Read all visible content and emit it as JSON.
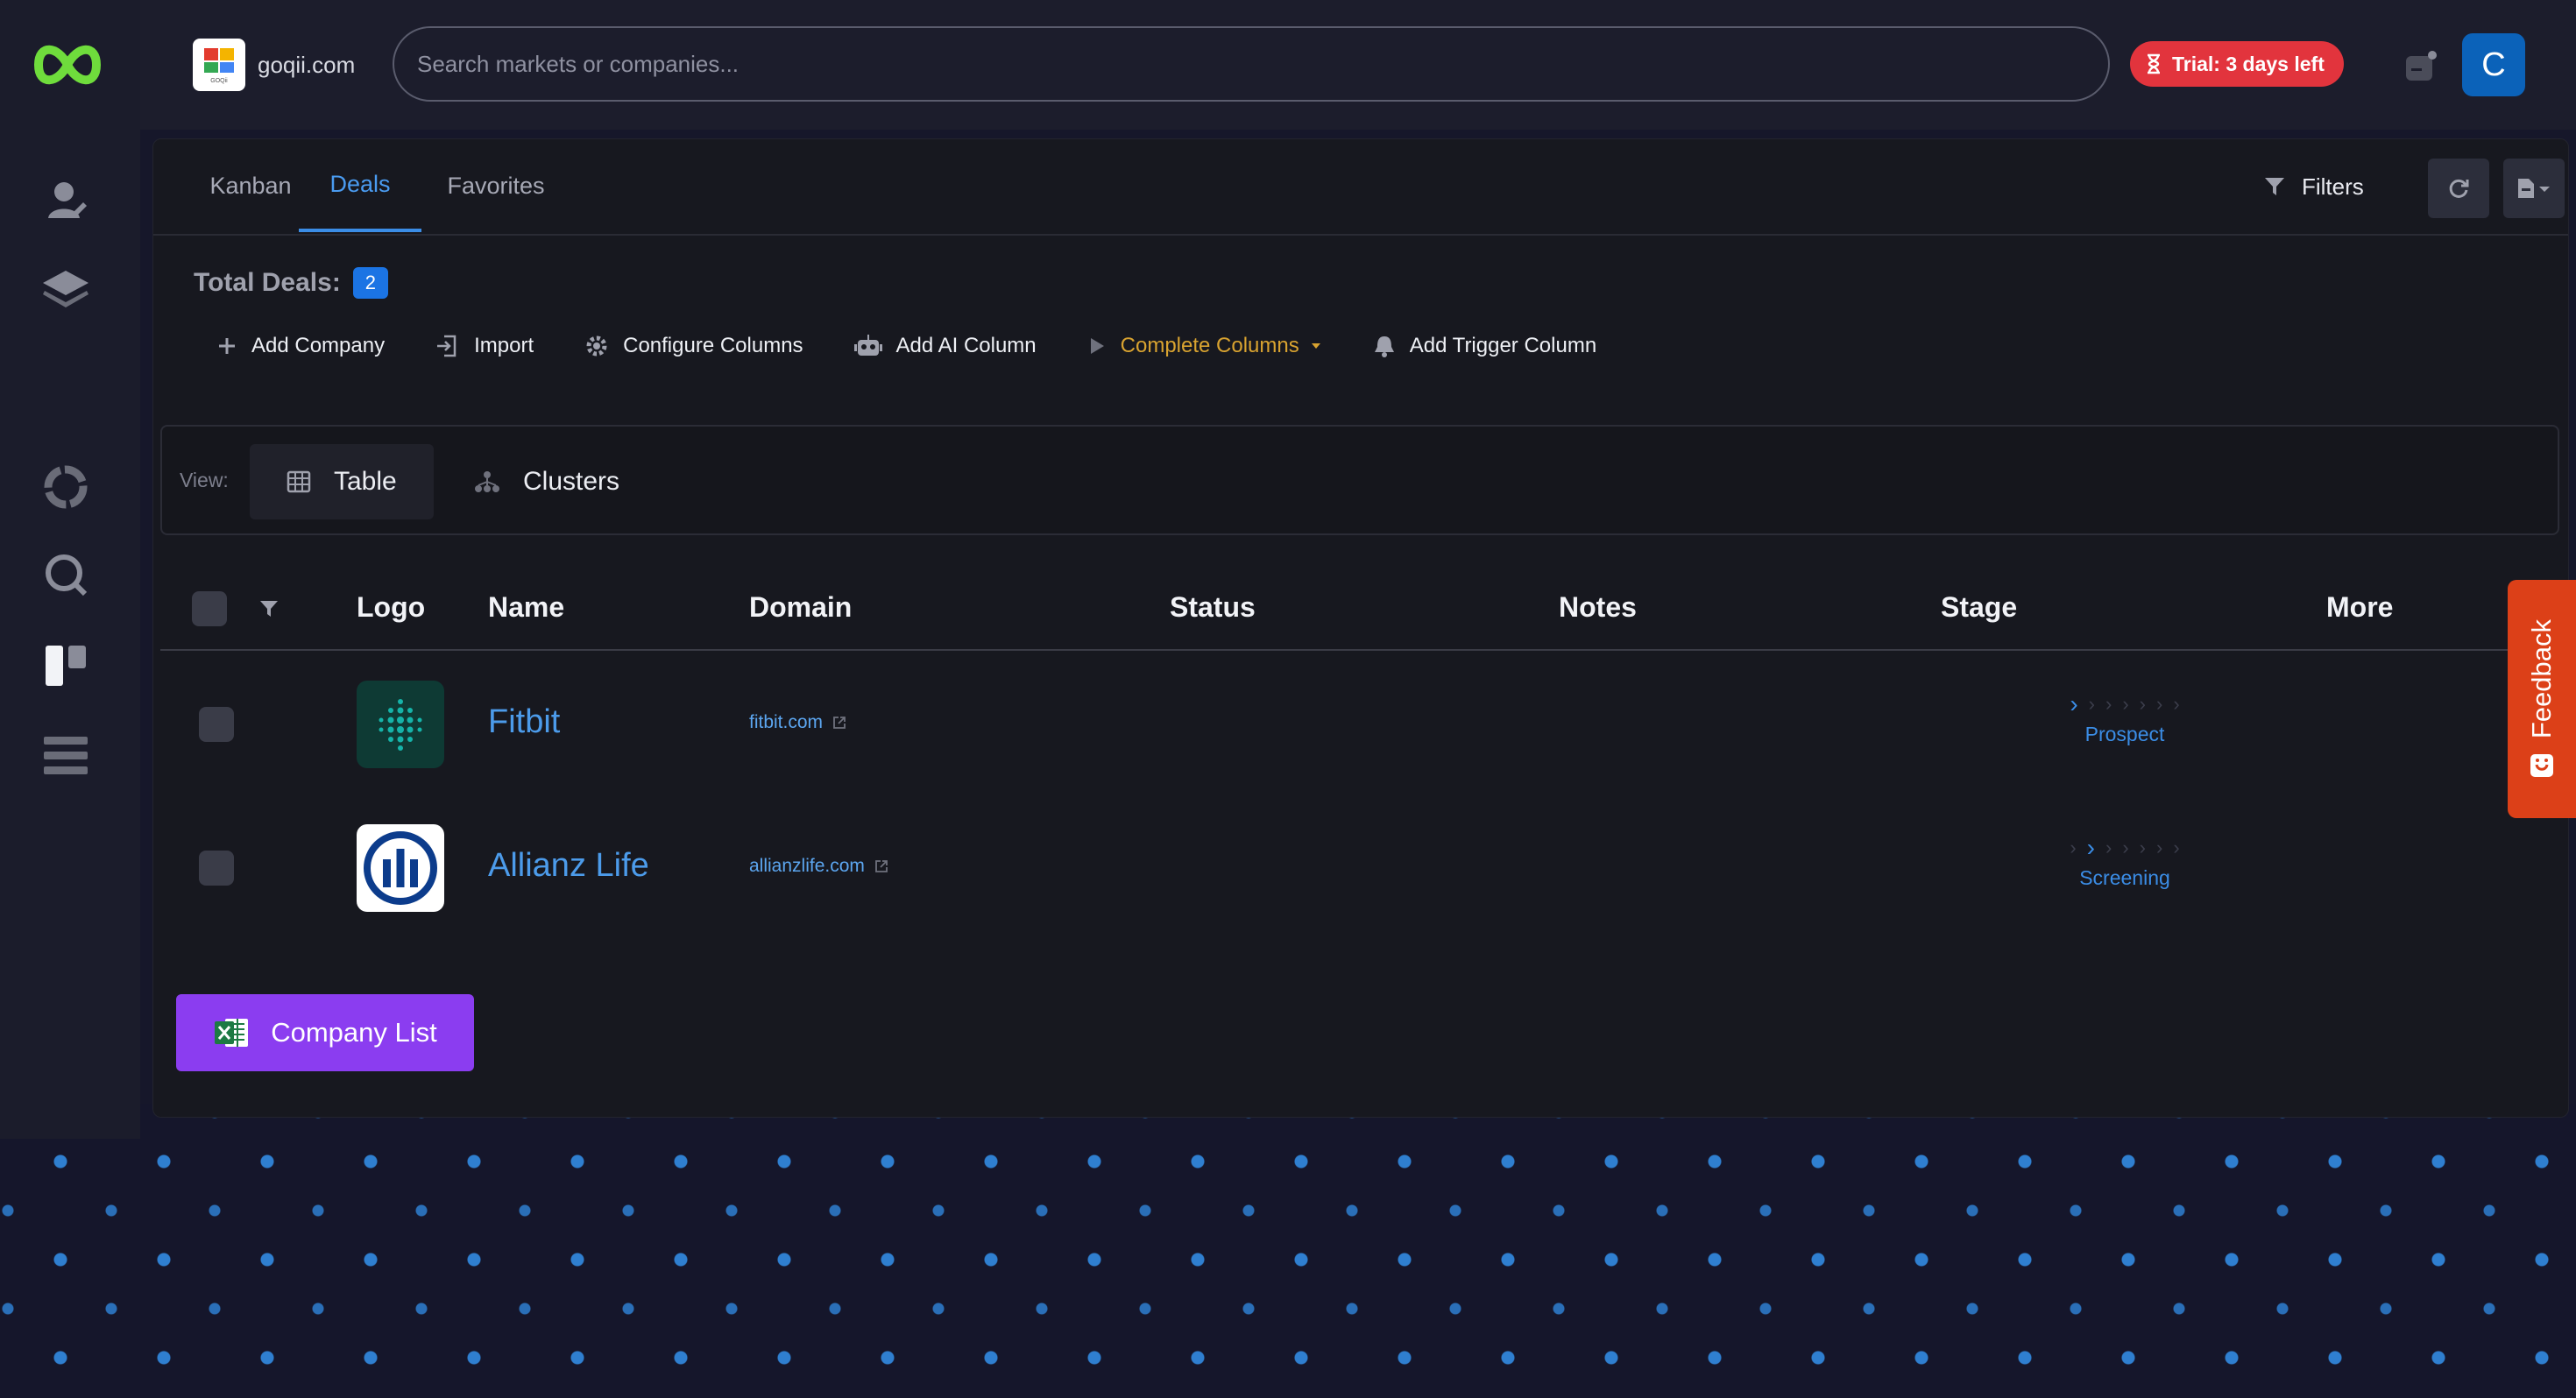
{
  "org": {
    "name": "goqii.com",
    "logo_caption": "GOQii"
  },
  "search": {
    "placeholder": "Search markets or companies..."
  },
  "trial": {
    "label": "Trial: 3 days left"
  },
  "avatar": {
    "initial": "C"
  },
  "tabs": [
    {
      "label": "Kanban"
    },
    {
      "label": "Deals",
      "active": true
    },
    {
      "label": "Favorites"
    }
  ],
  "toolbar": {
    "filters_label": "Filters"
  },
  "summary": {
    "label": "Total Deals:",
    "count": "2"
  },
  "actions": [
    {
      "label": "Add Company",
      "icon": "plus-icon"
    },
    {
      "label": "Import",
      "icon": "import-icon"
    },
    {
      "label": "Configure Columns",
      "icon": "gear-icon"
    },
    {
      "label": "Add AI Column",
      "icon": "robot-icon"
    },
    {
      "label": "Complete Columns",
      "icon": "play-icon"
    },
    {
      "label": "Add Trigger Column",
      "icon": "bell-icon"
    }
  ],
  "view": {
    "label": "View:",
    "options": [
      {
        "label": "Table",
        "selected": true
      },
      {
        "label": "Clusters"
      }
    ]
  },
  "table": {
    "columns": [
      "Logo",
      "Name",
      "Domain",
      "Status",
      "Notes",
      "Stage",
      "More"
    ],
    "rows": [
      {
        "name": "Fitbit",
        "domain": "fitbit.com",
        "status": "",
        "notes": "",
        "stage": "Prospect",
        "stage_index": 0
      },
      {
        "name": "Allianz Life",
        "domain": "allianzlife.com",
        "status": "",
        "notes": "",
        "stage": "Screening",
        "stage_index": 1
      }
    ]
  },
  "export_button": {
    "label": "Company List"
  },
  "feedback": {
    "label": "Feedback"
  },
  "colors": {
    "accent": "#3b8de6",
    "trial": "#e2343d",
    "export": "#8b3df0",
    "feedback": "#dc4018",
    "brand": "#6fdc3c"
  }
}
